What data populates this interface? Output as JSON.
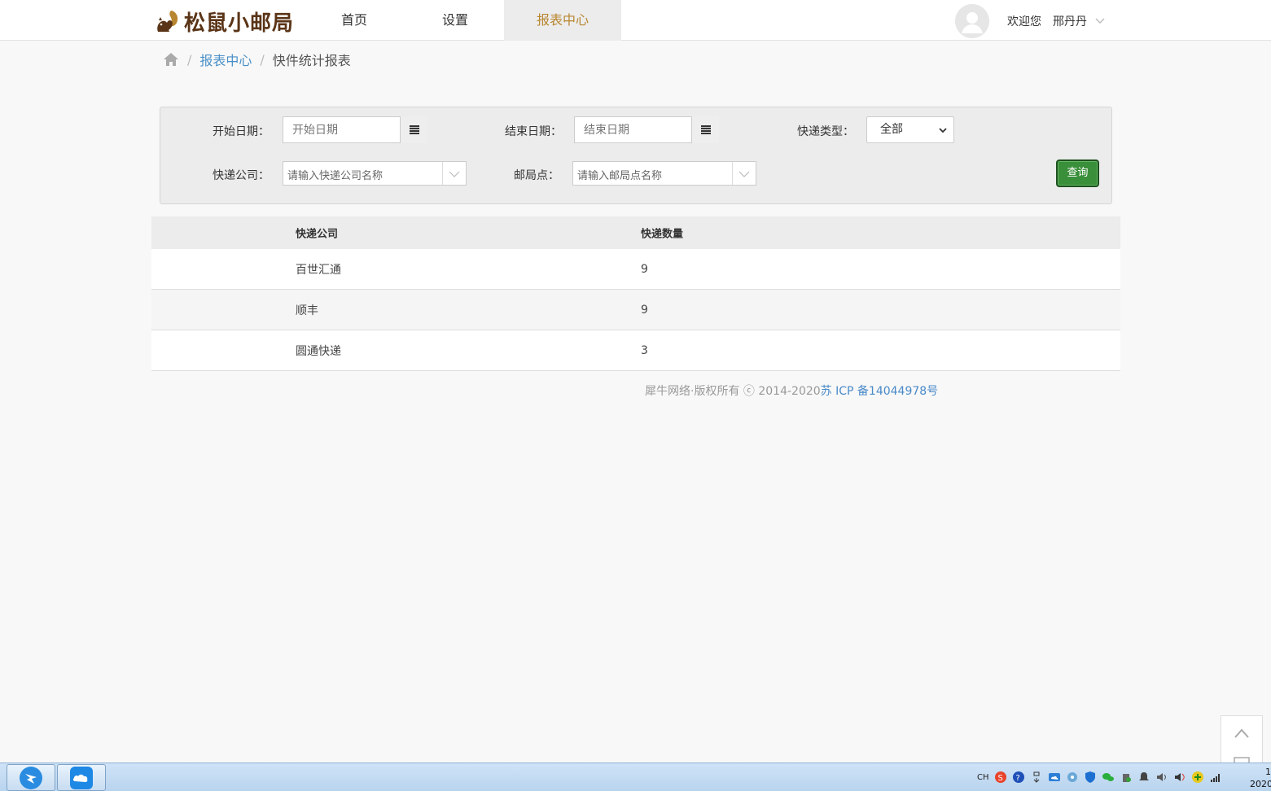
{
  "header": {
    "logo_text": "松鼠小邮局",
    "nav": [
      "首页",
      "设置",
      "报表中心"
    ],
    "active_nav": "报表中心",
    "welcome": "欢迎您",
    "username": "邢丹丹",
    "colors": {
      "logo": "#5a3417",
      "active_nav": "#b8862f"
    }
  },
  "breadcrumb": {
    "link": "报表中心",
    "current": "快件统计报表",
    "separator": "/"
  },
  "filter": {
    "start_date_label": "开始日期：",
    "start_date_placeholder": "开始日期",
    "end_date_label": "结束日期：",
    "end_date_placeholder": "结束日期",
    "type_label": "快递类型：",
    "type_value": "全部",
    "company_label": "快递公司：",
    "company_placeholder": "请输入快递公司名称",
    "post_label": "邮局点：",
    "post_placeholder": "请输入邮局点名称",
    "query_label": "查询",
    "query_color": "#3a8f3a"
  },
  "table": {
    "headers": [
      "快递公司",
      "快递数量"
    ],
    "rows": [
      {
        "company": "百世汇通",
        "count": "9"
      },
      {
        "company": "顺丰",
        "count": "9"
      },
      {
        "company": "圆通快递",
        "count": "3"
      }
    ]
  },
  "footer": {
    "copyright": "犀牛网络·版权所有 ⓒ 2014-2020",
    "icp": "苏 ICP 备14044978号"
  },
  "taskbar": {
    "ime": "CH",
    "clock_top": "1",
    "clock_bottom": "2020"
  }
}
